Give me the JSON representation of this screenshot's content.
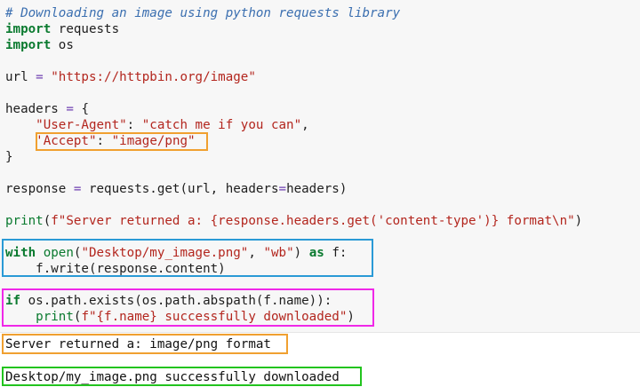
{
  "code": {
    "comment": "# Downloading an image using python requests library",
    "import_kw": "import",
    "import1_mod": "requests",
    "import2_mod": "os",
    "url_lhs": "url ",
    "eq": "=",
    "url_str": "\"https://httpbin.org/image\"",
    "headers_lhs": "headers ",
    "brace_open": "{",
    "ua_key": "\"User-Agent\"",
    "ua_val": "\"catch me if you can\"",
    "accept_key": "'Accept\"",
    "accept_val": "\"image/png\"",
    "brace_close": "}",
    "resp_lhs": "response ",
    "resp_call_a": " requests.get(url, headers",
    "resp_call_b": "headers)",
    "print_fn": "print",
    "print_open": "(",
    "fstring": "f\"Server returned a: {response.headers.get(",
    "ct_str": "'content-type'",
    "fstring_end": ")} format\\n\"",
    "print_close": ")",
    "with_kw": "with",
    "open_fn": "open",
    "open_args_a": "\"Desktop/my_image.png\"",
    "open_args_b": "\"wb\"",
    "as_kw": "as",
    "with_tail": " f:",
    "write_line": "    f.write(response.content)",
    "if_kw": "if",
    "if_rest": " os.path.exists(os.path.abspath(f.name)):",
    "indent": "    ",
    "print2_str": "f\"{f.name} successfully downloaded\"",
    "print2_close": ")"
  },
  "output": {
    "line1": "Server returned a: image/png format",
    "line2": "Desktop/my_image.png successfully downloaded"
  },
  "colors": {
    "orange": "#f0a030",
    "blue": "#2a9ad6",
    "magenta": "#f028e8",
    "green": "#22c41e"
  }
}
